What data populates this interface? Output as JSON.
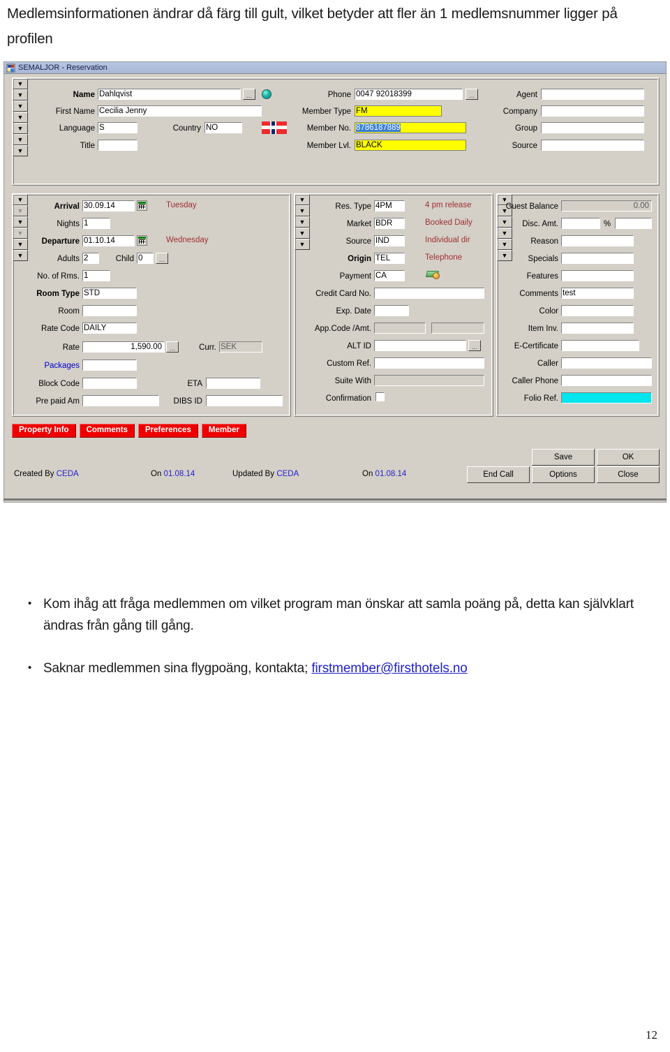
{
  "document": {
    "heading": "Medlemsinformationen ändrar då färg till gult, vilket betyder att fler än 1 medlemsnummer ligger på profilen",
    "page_number": "12",
    "bullets": [
      {
        "bullet": "•",
        "text": "Kom ihåg att fråga medlemmen om vilket program man önskar att samla poäng på, detta kan självklart ändras från gång till gång."
      },
      {
        "bullet": "•",
        "text_before": "Saknar medlemmen sina flygpoäng, kontakta; ",
        "link": "firstmember@firsthotels.no"
      }
    ]
  },
  "window": {
    "title": "SEMALJOR - Reservation",
    "icon": "app-window-icon"
  },
  "guest_panel": {
    "name": {
      "label": "Name",
      "value": "Dahlqvist",
      "ellipsis": "...",
      "globe_icon": "globe-icon"
    },
    "first_name": {
      "label": "First Name",
      "value": "Cecilia Jenny"
    },
    "language": {
      "label": "Language",
      "value": "S"
    },
    "country": {
      "label": "Country",
      "value": "NO",
      "flag": "norway-flag-icon"
    },
    "title": {
      "label": "Title",
      "value": ""
    },
    "phone": {
      "label": "Phone",
      "value": "0047  92018399",
      "ellipsis": "..."
    },
    "member_type": {
      "label": "Member Type",
      "value": "FM"
    },
    "member_no": {
      "label": "Member No.",
      "value": "8786187889"
    },
    "member_lvl": {
      "label": "Member Lvl.",
      "value": "BLACK"
    },
    "agent": {
      "label": "Agent",
      "value": ""
    },
    "company": {
      "label": "Company",
      "value": ""
    },
    "group": {
      "label": "Group",
      "value": ""
    },
    "source": {
      "label": "Source",
      "value": ""
    }
  },
  "stay_panel": {
    "arrival": {
      "label": "Arrival",
      "value": "30.09.14",
      "weekday": "Tuesday",
      "calendar_icon": "calendar-icon"
    },
    "nights": {
      "label": "Nights",
      "value": "1"
    },
    "departure": {
      "label": "Departure",
      "value": "01.10.14",
      "weekday": "Wednesday",
      "calendar_icon": "calendar-icon"
    },
    "adults": {
      "label": "Adults",
      "value": "2"
    },
    "child": {
      "label": "Child",
      "value": "0",
      "ellipsis": "..."
    },
    "no_of_rms": {
      "label": "No. of Rms.",
      "value": "1"
    },
    "room_type": {
      "label": "Room Type",
      "value": "STD"
    },
    "room": {
      "label": "Room",
      "value": ""
    },
    "rate_code": {
      "label": "Rate Code",
      "value": "DAILY"
    },
    "rate": {
      "label": "Rate",
      "value": "1,590.00",
      "ellipsis": "..."
    },
    "curr": {
      "label": "Curr.",
      "value": "SEK"
    },
    "packages": {
      "label": "Packages",
      "value": ""
    },
    "block_code": {
      "label": "Block Code",
      "value": ""
    },
    "eta": {
      "label": "ETA",
      "value": ""
    },
    "pre_paid_am": {
      "label": "Pre paid Am",
      "value": ""
    },
    "dibs_id": {
      "label": "DIBS ID",
      "value": ""
    }
  },
  "booking_panel": {
    "res_type": {
      "label": "Res. Type",
      "value": "4PM",
      "desc": "4 pm release"
    },
    "market": {
      "label": "Market",
      "value": "BDR",
      "desc": "Booked Daily"
    },
    "source": {
      "label": "Source",
      "value": "IND",
      "desc": "Individual dir"
    },
    "origin": {
      "label": "Origin",
      "value": "TEL",
      "desc": "Telephone"
    },
    "payment": {
      "label": "Payment",
      "value": "CA",
      "icon": "money-icon"
    },
    "credit_card_no": {
      "label": "Credit Card No.",
      "value": ""
    },
    "exp_date": {
      "label": "Exp. Date",
      "value": ""
    },
    "app_code_amt": {
      "label": "App.Code /Amt.",
      "value": "",
      "value2": ""
    },
    "alt_id": {
      "label": "ALT ID",
      "value": "",
      "ellipsis": "..."
    },
    "custom_ref": {
      "label": "Custom Ref.",
      "value": ""
    },
    "suite_with": {
      "label": "Suite With",
      "value": ""
    },
    "confirmation": {
      "label": "Confirmation",
      "checked": false
    }
  },
  "extras_panel": {
    "guest_balance": {
      "label": "Guest Balance",
      "value": "0.00"
    },
    "disc_amt": {
      "label": "Disc. Amt.",
      "value": "",
      "percent_label": "%",
      "percent_value": ""
    },
    "reason": {
      "label": "Reason",
      "value": ""
    },
    "specials": {
      "label": "Specials",
      "value": ""
    },
    "features": {
      "label": "Features",
      "value": ""
    },
    "comments": {
      "label": "Comments",
      "value": "test"
    },
    "color": {
      "label": "Color",
      "value": ""
    },
    "item_inv": {
      "label": "Item Inv.",
      "value": ""
    },
    "e_certificate": {
      "label": "E-Certificate",
      "value": ""
    },
    "caller": {
      "label": "Caller",
      "value": ""
    },
    "caller_phone": {
      "label": "Caller Phone",
      "value": ""
    },
    "folio_ref": {
      "label": "Folio Ref.",
      "value": ""
    }
  },
  "tabs": [
    {
      "label": "Property Info"
    },
    {
      "label": "Comments"
    },
    {
      "label": "Preferences"
    },
    {
      "label": "Member"
    }
  ],
  "footer": {
    "created_by_label": "Created By",
    "created_by_value": "CEDA",
    "created_on_label": "On",
    "created_on_value": "01.08.14",
    "updated_by_label": "Updated By",
    "updated_by_value": "CEDA",
    "updated_on_label": "On",
    "updated_on_value": "01.08.14",
    "buttons": {
      "save": "Save",
      "ok": "OK",
      "end_call": "End Call",
      "options": "Options",
      "close": "Close"
    }
  },
  "colors": {
    "highlight_yellow": "#ffff00",
    "selection_blue": "#3a7fd5",
    "folio_cyan": "#00e5ee",
    "tab_red": "#ee0000",
    "desc_red": "#a03030",
    "link_blue": "#2222cc",
    "window_face": "#d4d0c8"
  }
}
